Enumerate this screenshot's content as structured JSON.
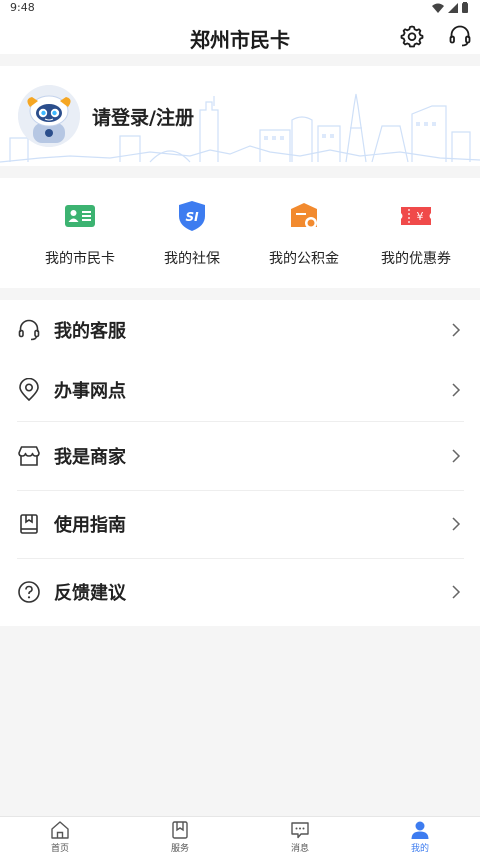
{
  "status_bar": {
    "time": "9:48"
  },
  "header": {
    "title": "郑州市民卡",
    "settings_icon": "gear-icon",
    "service_icon": "headset-icon"
  },
  "login": {
    "text": "请登录/注册"
  },
  "quick_actions": [
    {
      "label": "我的市民卡",
      "icon": "card-icon",
      "color": "#3cb371"
    },
    {
      "label": "我的社保",
      "icon": "shield-icon",
      "color": "#3d7cf0",
      "badge": "SI"
    },
    {
      "label": "我的公积金",
      "icon": "wallet-icon",
      "color": "#f28a2e"
    },
    {
      "label": "我的优惠券",
      "icon": "coupon-icon",
      "color": "#f04a4a",
      "badge": "¥"
    }
  ],
  "menu": [
    {
      "label": "我的客服",
      "icon": "headset-icon"
    },
    {
      "label": "办事网点",
      "icon": "location-pin-icon"
    },
    {
      "label": "我是商家",
      "icon": "store-icon"
    },
    {
      "label": "使用指南",
      "icon": "book-icon"
    },
    {
      "label": "反馈建议",
      "icon": "question-icon"
    }
  ],
  "tabs": [
    {
      "label": "首页",
      "icon": "home-icon",
      "active": false
    },
    {
      "label": "服务",
      "icon": "bookmark-icon",
      "active": false
    },
    {
      "label": "消息",
      "icon": "message-icon",
      "active": false
    },
    {
      "label": "我的",
      "icon": "user-icon",
      "active": true
    }
  ],
  "colors": {
    "accent": "#3d7cf0",
    "background": "#f5f5f5"
  }
}
